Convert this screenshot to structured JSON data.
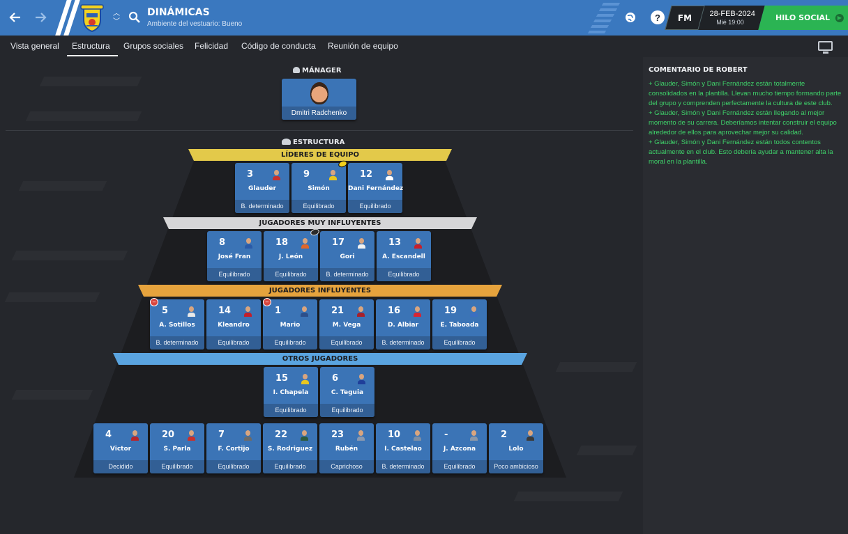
{
  "header": {
    "title": "DINÁMICAS",
    "subtitle": "Ambiente del vestuario: Bueno",
    "date": "28-FEB-2024",
    "time": "Mié 19:00",
    "fm_label": "FM",
    "social_label": "HILO SOCIAL",
    "help_label": "?"
  },
  "tabs": [
    "Vista general",
    "Estructura",
    "Grupos sociales",
    "Felicidad",
    "Código de conducta",
    "Reunión de equipo"
  ],
  "manager": {
    "section_label": "MÁNAGER",
    "name": "Dmitri Radchenko"
  },
  "structure_label": "ESTRUCTURA",
  "tiers": {
    "leaders": {
      "label": "LÍDERES DE EQUIPO",
      "color": "#e3c94a",
      "players": [
        {
          "number": "3",
          "name": "Glauder",
          "personality": "B. determinado",
          "kit": "#c9302c"
        },
        {
          "number": "9",
          "name": "Simón",
          "personality": "Equilibrado",
          "kit": "#e8c620"
        },
        {
          "number": "12",
          "name": "Dani Fernández",
          "personality": "Equilibrado",
          "kit": "#ffffff"
        }
      ]
    },
    "very_influential": {
      "label": "JUGADORES MUY INFLUYENTES",
      "color": "#d6d6d8",
      "players": [
        {
          "number": "8",
          "name": "José Fran",
          "personality": "Equilibrado",
          "kit": "#2a5aa8"
        },
        {
          "number": "18",
          "name": "J. León",
          "personality": "Equilibrado",
          "kit": "#e0672a"
        },
        {
          "number": "17",
          "name": "Gori",
          "personality": "B. determinado",
          "kit": "#f2f2f2"
        },
        {
          "number": "13",
          "name": "A. Escandell",
          "personality": "Equilibrado",
          "kit": "#c8202a"
        }
      ]
    },
    "influential": {
      "label": "JUGADORES INFLUYENTES",
      "color": "#e6a33d",
      "players": [
        {
          "number": "5",
          "name": "A. Sotillos",
          "personality": "B. determinado",
          "kit": "#e9e9e9"
        },
        {
          "number": "14",
          "name": "Kleandro",
          "personality": "Equilibrado",
          "kit": "#c41e2a"
        },
        {
          "number": "1",
          "name": "Mario",
          "personality": "Equilibrado",
          "kit": "#2c4f8a"
        },
        {
          "number": "21",
          "name": "M. Vega",
          "personality": "Equilibrado",
          "kit": "#a8202a"
        },
        {
          "number": "16",
          "name": "D. Albiar",
          "personality": "B. determinado",
          "kit": "#d92432"
        },
        {
          "number": "19",
          "name": "E. Taboada",
          "personality": "Equilibrado",
          "kit": "#3b6fc1"
        }
      ]
    },
    "others": {
      "label": "OTROS JUGADORES",
      "color": "#5aa4e0",
      "players_row1": [
        {
          "number": "15",
          "name": "I. Chapela",
          "personality": "Equilibrado",
          "kit": "#e8c620"
        },
        {
          "number": "6",
          "name": "C. Teguia",
          "personality": "Equilibrado",
          "kit": "#1f3f9a"
        }
      ],
      "players_row2": [
        {
          "number": "4",
          "name": "Victor",
          "personality": "Decidido",
          "kit": "#b8242a"
        },
        {
          "number": "20",
          "name": "S. Parla",
          "personality": "Equilibrado",
          "kit": "#c9302c"
        },
        {
          "number": "7",
          "name": "F. Cortijo",
          "personality": "Equilibrado",
          "kit": "#6b6b6b"
        },
        {
          "number": "22",
          "name": "S. Rodriguez",
          "personality": "Equilibrado",
          "kit": "#2d5a3d"
        },
        {
          "number": "23",
          "name": "Rubén",
          "personality": "Caprichoso",
          "kit": "#8a99b0"
        },
        {
          "number": "10",
          "name": "I. Castelao",
          "personality": "B. determinado",
          "kit": "#7e8fa6"
        },
        {
          "number": "-",
          "name": "J. Azcona",
          "personality": "Equilibrado",
          "kit": "#8b97a8"
        },
        {
          "number": "2",
          "name": "Lolo",
          "personality": "Poco ambicioso",
          "kit": "#3a3a3a"
        }
      ]
    }
  },
  "comment": {
    "title": "COMENTARIO DE ROBERT",
    "items": [
      "+    Glauder, Simón y Dani Fernández están totalmente consolidados en la plantilla. Llevan mucho tiempo formando parte del grupo y comprenden perfectamente la cultura de este club.",
      "+    Glauder, Simón y Dani Fernández están llegando al mejor momento de su carrera. Deberíamos intentar construir el equipo alrededor de ellos para aprovechar mejor su calidad.",
      "+    Glauder, Simón y Dani Fernández están todos contentos actualmente en el club. Esto debería ayudar a mantener alta la moral en la plantilla."
    ]
  },
  "colors": {
    "topbar": "#3a78bf",
    "card": "#3b74b6",
    "social": "#2bb453",
    "comment_text": "#3fd36a"
  }
}
